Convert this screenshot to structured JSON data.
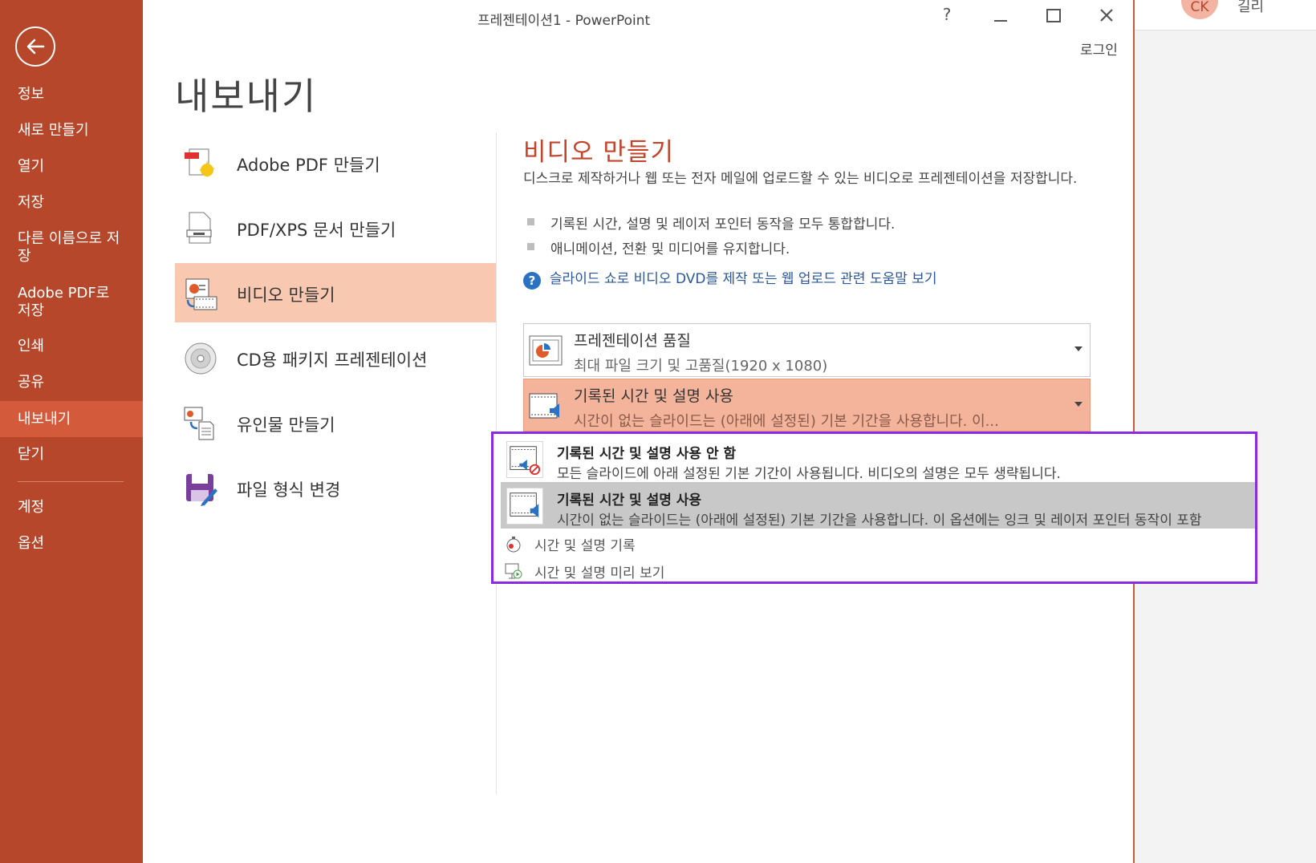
{
  "window": {
    "title": "프레젠테이션1 - PowerPoint",
    "help_label": "?",
    "login_label": "로그인"
  },
  "background_app": {
    "avatar_initials": "CK",
    "user_name_partial": "길리"
  },
  "sidebar": {
    "items": [
      {
        "label": "정보"
      },
      {
        "label": "새로 만들기"
      },
      {
        "label": "열기"
      },
      {
        "label": "저장"
      },
      {
        "label": "다른 이름으로 저장"
      },
      {
        "label": "Adobe PDF로 저장"
      },
      {
        "label": "인쇄"
      },
      {
        "label": "공유"
      },
      {
        "label": "내보내기",
        "active": true
      },
      {
        "label": "닫기"
      },
      {
        "label": "계정"
      },
      {
        "label": "옵션"
      }
    ]
  },
  "page": {
    "title": "내보내기"
  },
  "export_options": [
    {
      "label": "Adobe PDF 만들기",
      "icon": "adobe-pdf-icon"
    },
    {
      "label": "PDF/XPS 문서 만들기",
      "icon": "pdf-xps-icon"
    },
    {
      "label": "비디오 만들기",
      "icon": "video-icon",
      "selected": true
    },
    {
      "label": "CD용 패키지 프레젠테이션",
      "icon": "cd-icon"
    },
    {
      "label": "유인물 만들기",
      "icon": "handouts-icon"
    },
    {
      "label": "파일 형식 변경",
      "icon": "save-as-icon"
    }
  ],
  "video_panel": {
    "title": "비디오 만들기",
    "description": "디스크로 제작하거나 웹 또는 전자 메일에 업로드할 수 있는 비디오로 프레젠테이션을 저장합니다.",
    "bullets": [
      "기록된 시간, 설명 및 레이저 포인터 동작을 모두 통합합니다.",
      "애니메이션, 전환 및 미디어를 유지합니다."
    ],
    "help_link": "슬라이드 쇼로 비디오 DVD를 제작 또는 웹 업로드 관련 도움말 보기",
    "quality_dropdown": {
      "title": "프레젠테이션 품질",
      "subtitle": "최대 파일 크기 및 고품질(1920 x 1080)"
    },
    "timings_dropdown": {
      "title": "기록된 시간 및 설명 사용",
      "subtitle": "시간이 없는 슬라이드는 (아래에 설정된) 기본 기간을 사용합니다. 이..."
    }
  },
  "timings_menu": {
    "items": [
      {
        "title": "기록된 시간 및 설명 사용 안 함",
        "subtitle": "모든 슬라이드에 아래 설정된 기본 기간이 사용됩니다. 비디오의 설명은 모두 생략됩니다."
      },
      {
        "title": "기록된 시간 및 설명 사용",
        "subtitle": "시간이 없는 슬라이드는 (아래에 설정된) 기본 기간을 사용합니다. 이 옵션에는 잉크 및 레이저 포인터 동작이 포함",
        "highlighted": true
      }
    ],
    "actions": [
      {
        "label": "시간 및 설명 기록"
      },
      {
        "label": "시간 및 설명 미리 보기"
      }
    ]
  },
  "colors": {
    "sidebar_bg": "#b7472a",
    "sidebar_active": "#d35a3b",
    "selected_item_bg": "#f9c8b1",
    "accent_title": "#c4442a",
    "link": "#2b579a",
    "menu_border": "#8a2be2"
  }
}
